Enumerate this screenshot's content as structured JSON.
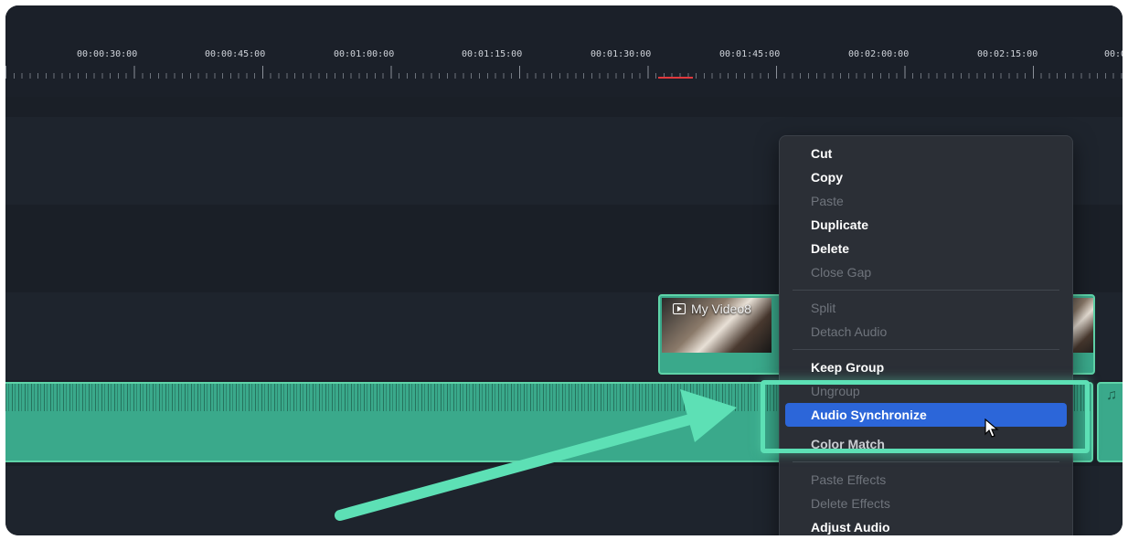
{
  "ruler": {
    "labels": [
      "00:00:30:00",
      "00:00:45:00",
      "00:01:00:00",
      "00:01:15:00",
      "00:01:30:00",
      "00:01:45:00",
      "00:02:00:00",
      "00:02:15:00",
      "00:0"
    ]
  },
  "video_clip": {
    "title": "My Video8"
  },
  "context_menu": {
    "items": [
      {
        "label": "Cut",
        "enabled": true
      },
      {
        "label": "Copy",
        "enabled": true
      },
      {
        "label": "Paste",
        "enabled": false
      },
      {
        "label": "Duplicate",
        "enabled": true
      },
      {
        "label": "Delete",
        "enabled": true
      },
      {
        "label": "Close Gap",
        "enabled": false
      },
      {
        "label": "Split",
        "enabled": false
      },
      {
        "label": "Detach Audio",
        "enabled": false
      },
      {
        "label": "Keep Group",
        "enabled": true
      },
      {
        "label": "Ungroup",
        "enabled": false
      },
      {
        "label": "Audio Synchronize",
        "enabled": true,
        "highlighted": true
      },
      {
        "label": "Color Match",
        "enabled": true
      },
      {
        "label": "Paste Effects",
        "enabled": false
      },
      {
        "label": "Delete Effects",
        "enabled": false
      },
      {
        "label": "Adjust Audio",
        "enabled": true
      }
    ]
  },
  "colors": {
    "accent_highlight": "#5de0b5",
    "menu_selection": "#2c66d9",
    "clip": "#3aa98b"
  }
}
